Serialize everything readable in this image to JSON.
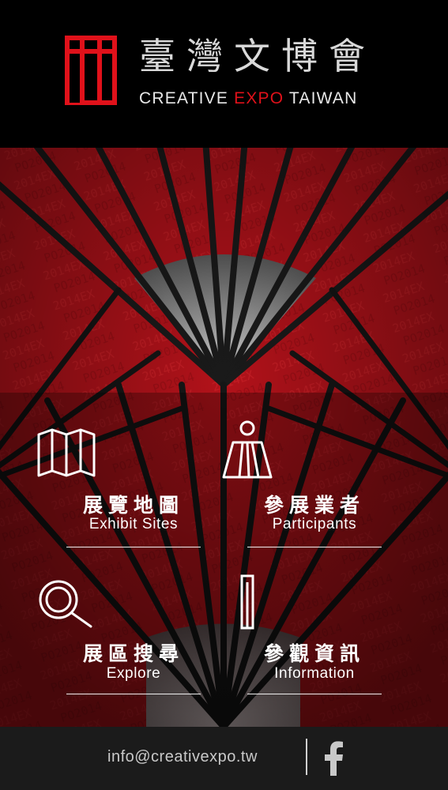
{
  "header": {
    "title_cn": "臺灣文博會",
    "title_en_before": "CREATIVE ",
    "title_en_accent": "EXPO",
    "title_en_after": " TAIWAN"
  },
  "menu": [
    {
      "cn": "展覽地圖",
      "en": "Exhibit Sites",
      "icon": "map-icon"
    },
    {
      "cn": "參展業者",
      "en": "Participants",
      "icon": "person-icon"
    },
    {
      "cn": "展區搜尋",
      "en": "Explore",
      "icon": "magnifier-icon"
    },
    {
      "cn": "參觀資訊",
      "en": "Information",
      "icon": "info-icon"
    }
  ],
  "footer": {
    "email": "info@creativexpo.tw",
    "social_icon": "facebook-icon"
  },
  "colors": {
    "accent": "#e0111a",
    "background": "#000000",
    "footer": "#1b1b1b"
  }
}
